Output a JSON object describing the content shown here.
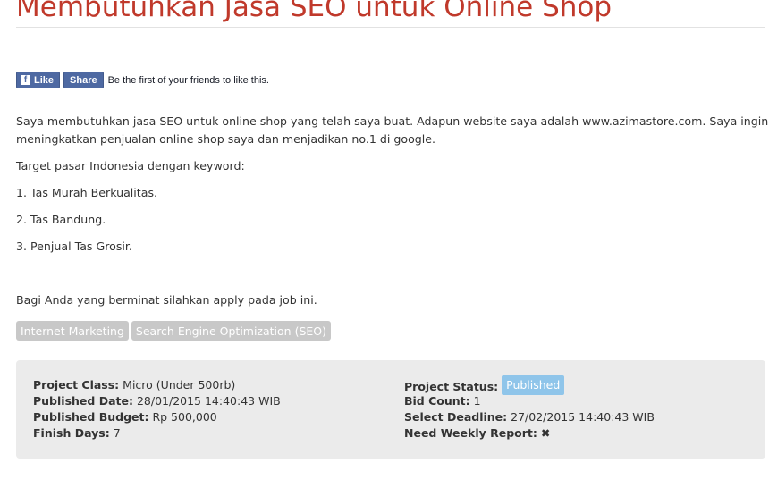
{
  "page": {
    "title": "Membutuhkan Jasa SEO untuk Online Shop"
  },
  "facebook": {
    "like_label": "Like",
    "like_icon": "f",
    "share_label": "Share",
    "social_text": "Be the first of your friends to like this."
  },
  "description": {
    "paragraph1_line1": "Saya membutuhkan jasa SEO untuk online shop yang telah saya buat. Adapun website saya adalah www.azimastore.com. Saya ingin",
    "paragraph1_line2": "meningkatkan penjualan online shop saya dan menjadikan no.1 di google.",
    "target": "Target pasar Indonesia dengan keyword:",
    "keyword1": "1. Tas Murah Berkualitas.",
    "keyword2": "2. Tas Bandung.",
    "keyword3": "3. Penjual Tas Grosir.",
    "closing": "Bagi Anda yang berminat silahkan apply pada job ini."
  },
  "tags": [
    "Internet Marketing",
    "Search Engine Optimization (SEO)"
  ],
  "details": {
    "project_class_label": "Project Class:",
    "project_class_value": "Micro (Under 500rb)",
    "published_date_label": "Published Date:",
    "published_date_value": "28/01/2015 14:40:43 WIB",
    "published_budget_label": "Published Budget:",
    "published_budget_value": "Rp 500,000",
    "finish_days_label": "Finish Days:",
    "finish_days_value": "7",
    "project_status_label": "Project Status:",
    "project_status_value": "Published",
    "bid_count_label": "Bid Count:",
    "bid_count_value": "1",
    "select_deadline_label": "Select Deadline:",
    "select_deadline_value": "27/02/2015 14:40:43 WIB",
    "weekly_report_label": "Need Weekly Report:",
    "weekly_report_icon": "✖"
  },
  "colors": {
    "title": "#c0392b",
    "facebook": "#4e69a2",
    "tag_bg": "#c8c8c8",
    "panel_bg": "#ebebeb",
    "status_badge": "#8fc5ea"
  }
}
